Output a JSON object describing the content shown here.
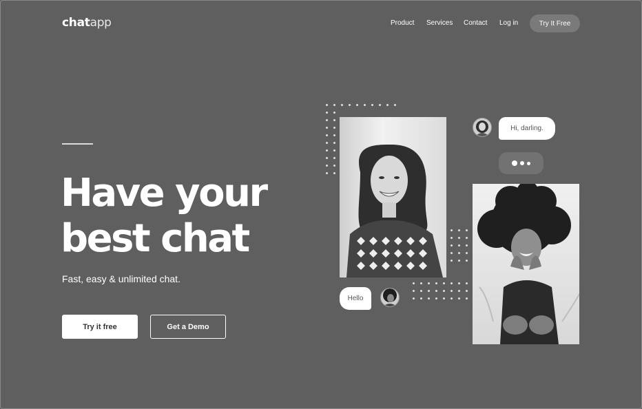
{
  "brand": {
    "logo_bold": "chat",
    "logo_light": "app"
  },
  "nav": {
    "items": [
      {
        "label": "Product"
      },
      {
        "label": "Services"
      },
      {
        "label": "Contact"
      },
      {
        "label": "Log in"
      }
    ],
    "cta_label": "Try It Free"
  },
  "hero": {
    "headline_line1": "Have your",
    "headline_line2": "best chat",
    "subtitle": "Fast, easy & unlimited chat.",
    "primary_button": "Try it free",
    "secondary_button": "Get a Demo"
  },
  "chat": {
    "message_incoming": "Hi, darling.",
    "message_outgoing": "Hello",
    "typing_icon": "typing-dots-icon"
  },
  "colors": {
    "background": "#5f5f5f",
    "text": "#ffffff",
    "nav_button_bg": "#7a7a7a",
    "bubble_bg": "#ffffff",
    "typing_bg": "#727272"
  }
}
